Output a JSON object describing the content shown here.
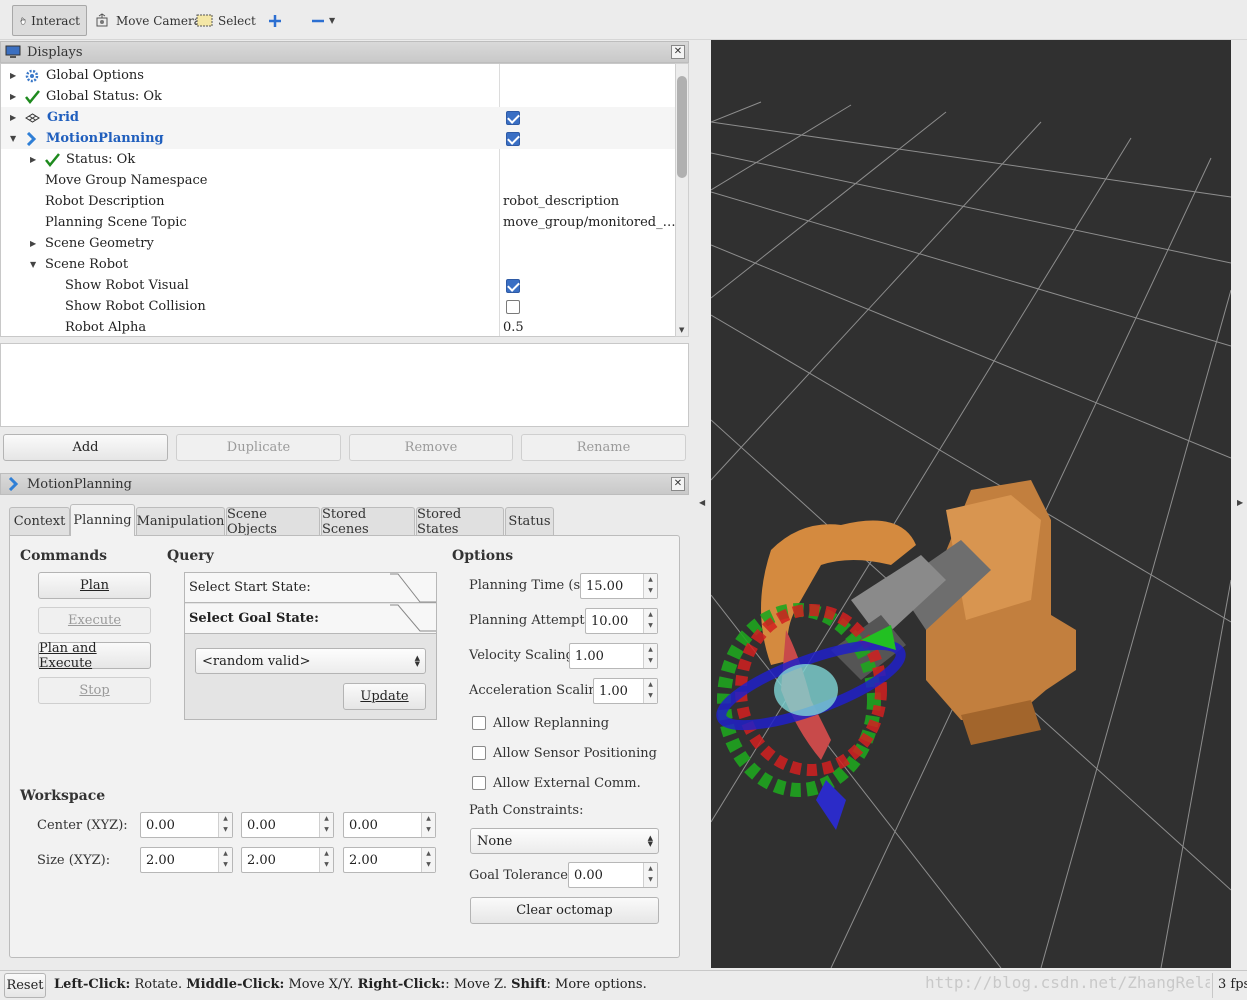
{
  "toolbar": {
    "interact": "Interact",
    "move_camera": "Move Camera",
    "select": "Select"
  },
  "displays": {
    "title": "Displays",
    "rows": [
      {
        "label": "Global Options"
      },
      {
        "label": "Global Status: Ok"
      },
      {
        "label": "Grid",
        "checked": true
      },
      {
        "label": "MotionPlanning",
        "checked": true
      },
      {
        "label": "Status: Ok"
      },
      {
        "label": "Move Group Namespace",
        "value": ""
      },
      {
        "label": "Robot Description",
        "value": "robot_description"
      },
      {
        "label": "Planning Scene Topic",
        "value": "move_group/monitored_…"
      },
      {
        "label": "Scene Geometry"
      },
      {
        "label": "Scene Robot"
      },
      {
        "label": "Show Robot Visual",
        "checked": true
      },
      {
        "label": "Show Robot Collision",
        "checked": false
      },
      {
        "label": "Robot Alpha",
        "value": "0.5"
      }
    ],
    "buttons": {
      "add": "Add",
      "duplicate": "Duplicate",
      "remove": "Remove",
      "rename": "Rename"
    }
  },
  "motion": {
    "title": "MotionPlanning",
    "tabs": [
      "Context",
      "Planning",
      "Manipulation",
      "Scene Objects",
      "Stored Scenes",
      "Stored States",
      "Status"
    ],
    "commands": {
      "title": "Commands",
      "plan": "Plan",
      "execute": "Execute",
      "plan_execute": "Plan and Execute",
      "stop": "Stop"
    },
    "query": {
      "title": "Query",
      "start": "Select Start State:",
      "goal": "Select Goal State:",
      "goal_value": "<random valid>",
      "update": "Update"
    },
    "options": {
      "title": "Options",
      "planning_time_label": "Planning Time (s):",
      "planning_time": "15.00",
      "attempts_label": "Planning Attempts:",
      "attempts": "10.00",
      "velocity_label": "Velocity Scaling:",
      "velocity": "1.00",
      "accel_label": "Acceleration Scaling:",
      "accel": "1.00",
      "allow_replanning": "Allow Replanning",
      "allow_sensor": "Allow Sensor Positioning",
      "allow_external": "Allow External Comm.",
      "path_constraints_label": "Path Constraints:",
      "path_constraints": "None",
      "goal_tol_label": "Goal Tolerance:",
      "goal_tol": "0.00",
      "clear_octomap": "Clear octomap"
    },
    "workspace": {
      "title": "Workspace",
      "center_label": "Center (XYZ):",
      "center": [
        "0.00",
        "0.00",
        "0.00"
      ],
      "size_label": "Size (XYZ):",
      "size": [
        "2.00",
        "2.00",
        "2.00"
      ]
    }
  },
  "status": {
    "reset": "Reset",
    "hint_l": "Left-Click:",
    "hint_l_t": " Rotate. ",
    "hint_m": "Middle-Click:",
    "hint_m_t": " Move X/Y. ",
    "hint_r": "Right-Click:",
    "hint_r_t": ": Move Z. ",
    "hint_s": "Shift",
    "hint_s_t": ": More options.",
    "fps": "3 fps",
    "watermark": "http://blog.csdn.net/ZhangRelay"
  }
}
